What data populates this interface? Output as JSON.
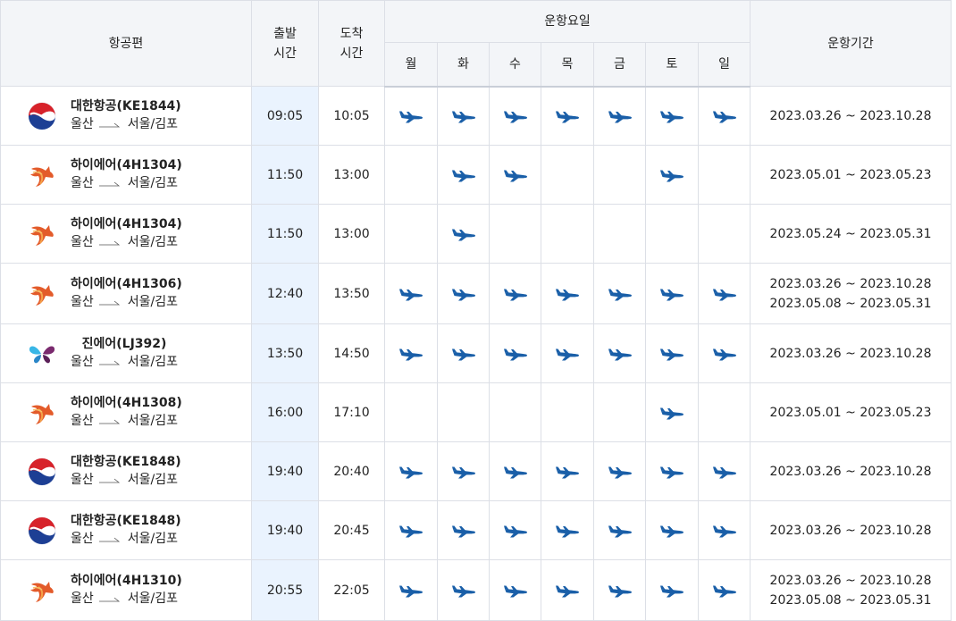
{
  "header": {
    "flight": "항공편",
    "departure": [
      "출발",
      "시간"
    ],
    "arrival": [
      "도착",
      "시간"
    ],
    "days_title": "운항요일",
    "days": [
      "월",
      "화",
      "수",
      "목",
      "금",
      "토",
      "일"
    ],
    "period": "운항기간"
  },
  "colors": {
    "plane": "#1a5fa8",
    "dep_column_bg": "#eaf3fe",
    "header_bg": "#f3f5f8"
  },
  "rows": [
    {
      "airline": "korean-air",
      "name": "대한항공(KE1844)",
      "origin": "울산",
      "dest": "서울/김포",
      "dep": "09:05",
      "arr": "10:05",
      "days": [
        true,
        true,
        true,
        true,
        true,
        true,
        true
      ],
      "periods": [
        "2023.03.26 ~ 2023.10.28"
      ]
    },
    {
      "airline": "hi-air",
      "name": "하이에어(4H1304)",
      "origin": "울산",
      "dest": "서울/김포",
      "dep": "11:50",
      "arr": "13:00",
      "days": [
        false,
        true,
        true,
        false,
        false,
        true,
        false
      ],
      "periods": [
        "2023.05.01 ~ 2023.05.23"
      ]
    },
    {
      "airline": "hi-air",
      "name": "하이에어(4H1304)",
      "origin": "울산",
      "dest": "서울/김포",
      "dep": "11:50",
      "arr": "13:00",
      "days": [
        false,
        true,
        false,
        false,
        false,
        false,
        false
      ],
      "periods": [
        "2023.05.24 ~ 2023.05.31"
      ]
    },
    {
      "airline": "hi-air",
      "name": "하이에어(4H1306)",
      "origin": "울산",
      "dest": "서울/김포",
      "dep": "12:40",
      "arr": "13:50",
      "days": [
        true,
        true,
        true,
        true,
        true,
        true,
        true
      ],
      "periods": [
        "2023.03.26 ~ 2023.10.28",
        "2023.05.08 ~ 2023.05.31"
      ]
    },
    {
      "airline": "jin-air",
      "name": "진에어(LJ392)",
      "origin": "울산",
      "dest": "서울/김포",
      "dep": "13:50",
      "arr": "14:50",
      "days": [
        true,
        true,
        true,
        true,
        true,
        true,
        true
      ],
      "periods": [
        "2023.03.26 ~ 2023.10.28"
      ]
    },
    {
      "airline": "hi-air",
      "name": "하이에어(4H1308)",
      "origin": "울산",
      "dest": "서울/김포",
      "dep": "16:00",
      "arr": "17:10",
      "days": [
        false,
        false,
        false,
        false,
        false,
        true,
        false
      ],
      "periods": [
        "2023.05.01 ~ 2023.05.23"
      ]
    },
    {
      "airline": "korean-air",
      "name": "대한항공(KE1848)",
      "origin": "울산",
      "dest": "서울/김포",
      "dep": "19:40",
      "arr": "20:40",
      "days": [
        true,
        true,
        true,
        true,
        true,
        true,
        true
      ],
      "periods": [
        "2023.03.26 ~ 2023.10.28"
      ]
    },
    {
      "airline": "korean-air",
      "name": "대한항공(KE1848)",
      "origin": "울산",
      "dest": "서울/김포",
      "dep": "19:40",
      "arr": "20:45",
      "days": [
        true,
        true,
        true,
        true,
        true,
        true,
        true
      ],
      "periods": [
        "2023.03.26 ~ 2023.10.28"
      ]
    },
    {
      "airline": "hi-air",
      "name": "하이에어(4H1310)",
      "origin": "울산",
      "dest": "서울/김포",
      "dep": "20:55",
      "arr": "22:05",
      "days": [
        true,
        true,
        true,
        true,
        true,
        true,
        true
      ],
      "periods": [
        "2023.03.26 ~ 2023.10.28",
        "2023.05.08 ~ 2023.05.31"
      ]
    }
  ]
}
